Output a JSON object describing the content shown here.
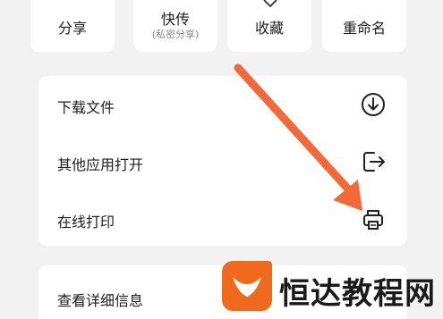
{
  "quick_actions": [
    {
      "label": "分享",
      "icon": "share-icon"
    },
    {
      "label": "快传",
      "sublabel": "(私密分享)",
      "icon": "send-icon"
    },
    {
      "label": "收藏",
      "icon": "star-icon"
    },
    {
      "label": "重命名",
      "icon": "rename-icon"
    }
  ],
  "menu": {
    "items": [
      {
        "label": "下载文件",
        "icon": "download-icon"
      },
      {
        "label": "其他应用打开",
        "icon": "open-external-icon"
      },
      {
        "label": "在线打印",
        "icon": "printer-icon"
      }
    ],
    "more_item": {
      "label": "查看详细信息"
    }
  },
  "annotation": {
    "color": "#f26a3a"
  },
  "watermark": {
    "text": "恒达教程网",
    "color": "#f06a1e"
  }
}
